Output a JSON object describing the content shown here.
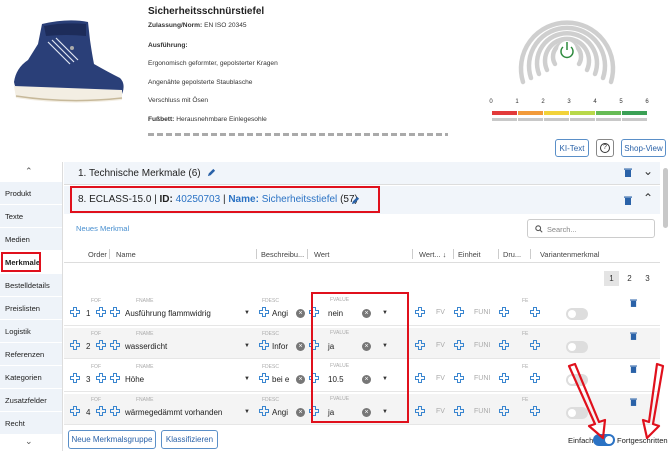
{
  "product": {
    "title": "Sicherheitsschnürstiefel",
    "lines": [
      {
        "label": "Zulassung/Norm:",
        "value": "EN ISO 20345"
      },
      {
        "label": "Ausführung:",
        "value": ""
      },
      {
        "label": "",
        "value": "Ergonomisch geformter, gepolsterter Kragen"
      },
      {
        "label": "",
        "value": "Angenähte gepolsterte Staublasche"
      },
      {
        "label": "",
        "value": "Verschluss mit Ösen"
      },
      {
        "label": "Fußbett:",
        "value": "Herausnehmbare Einlegesohle"
      }
    ]
  },
  "quality": {
    "scale": [
      "0",
      "1",
      "2",
      "3",
      "4",
      "5",
      "6"
    ],
    "colors": [
      "#e23a3a",
      "#f29a3a",
      "#f2d23a",
      "#b8d84a",
      "#66bb55",
      "#3aa055"
    ]
  },
  "top_buttons": {
    "ki_text": "KI-Text",
    "help": "?",
    "shop_view": "Shop-View"
  },
  "sidebar": {
    "items": [
      {
        "label": "Produkt"
      },
      {
        "label": "Texte"
      },
      {
        "label": "Medien"
      },
      {
        "label": "Merkmale"
      },
      {
        "label": "Bestelldetails"
      },
      {
        "label": "Preislisten"
      },
      {
        "label": "Logistik"
      },
      {
        "label": "Referenzen"
      },
      {
        "label": "Kategorien"
      },
      {
        "label": "Zusatzfelder"
      },
      {
        "label": "Recht"
      }
    ]
  },
  "section1": {
    "title": "1. Technische Merkmale (6)"
  },
  "section2": {
    "prefix": "8. ECLASS-15.0 |",
    "id_label": "ID:",
    "id_value": "40250703",
    "sep": "|",
    "name_label": "Name:",
    "name_value": "Sicherheitsstiefel",
    "count": "(57)"
  },
  "new_feature": "Neues Merkmal",
  "search_placeholder": "Search...",
  "columns": [
    "Order",
    "Name",
    "Beschreibu...",
    "Wert",
    "Wert... ↓",
    "Einheit",
    "Dru...",
    "Variantenmerkmal"
  ],
  "pagination": [
    "1",
    "2",
    "3"
  ],
  "rows": [
    {
      "order": "1",
      "name": "Ausführung flammwidrig",
      "desc": "Angi",
      "value": "nein",
      "fv": "FV",
      "funi": "FUNI"
    },
    {
      "order": "2",
      "name": "wasserdicht",
      "desc": "Infor",
      "value": "ja",
      "fv": "FV",
      "funi": "FUNI"
    },
    {
      "order": "3",
      "name": "Höhe",
      "desc": "bei e",
      "value": "10.5",
      "fv": "FV",
      "funi": "FUNI"
    },
    {
      "order": "4",
      "name": "wärmegedämmt vorhanden",
      "desc": "Angi",
      "value": "ja",
      "fv": "FV",
      "funi": "FUNI"
    }
  ],
  "field_tags": {
    "order": "FOF",
    "name": "FNAME",
    "desc": "FDESC",
    "value": "FVALUE",
    "dru": "FE"
  },
  "bottom": {
    "add_group": "Neue Merkmalsgruppe",
    "classify": "Klassifizieren",
    "mode_simple": "Einfach",
    "mode_advanced": "Fortgeschritten"
  },
  "accent": "#2a72c4",
  "highlight": "#e0101c"
}
